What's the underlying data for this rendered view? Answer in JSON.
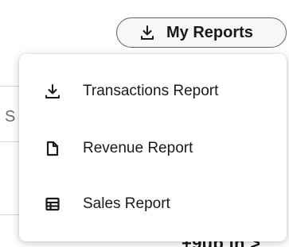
{
  "trigger": {
    "label": "My Reports",
    "icon": "download-icon"
  },
  "menu": {
    "items": [
      {
        "label": "Transactions Report",
        "icon": "download-icon"
      },
      {
        "label": "Revenue Report",
        "icon": "document-icon"
      },
      {
        "label": "Sales Report",
        "icon": "table-icon"
      }
    ]
  },
  "background": {
    "partial_letter": "S",
    "partial_text": "+9ub in >"
  },
  "colors": {
    "border": "#5f5f5f",
    "text": "#1a1a1a",
    "trigger_bg": "#f7f7f7",
    "menu_bg": "#ffffff"
  }
}
